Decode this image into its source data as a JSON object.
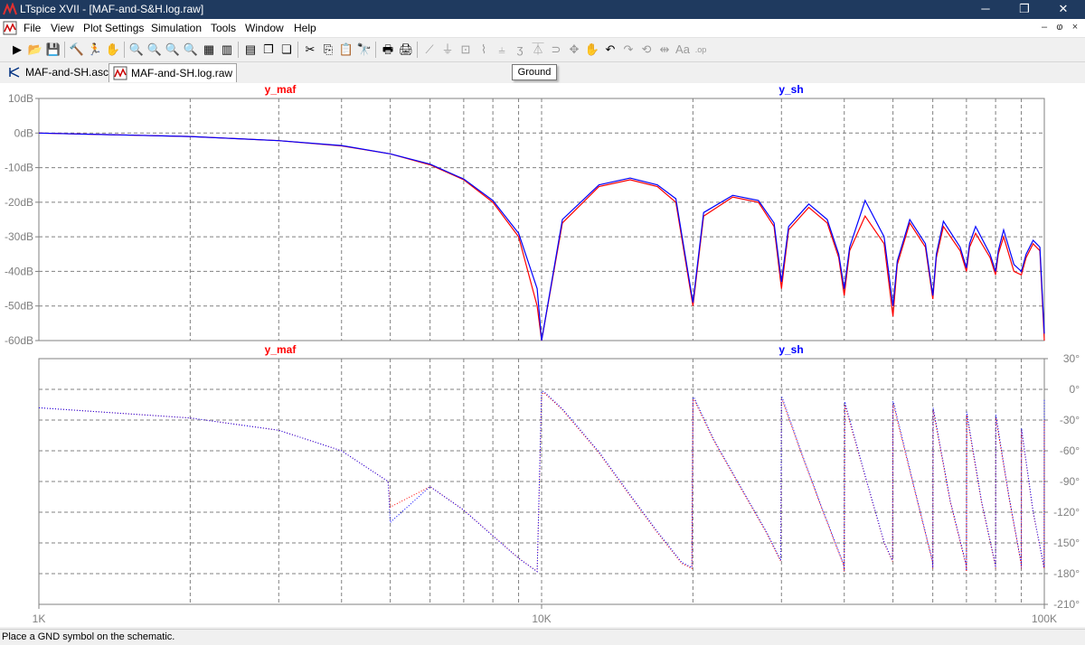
{
  "window": {
    "title": "LTspice XVII - [MAF-and-S&H.log.raw]",
    "minimize": "─",
    "restore": "❐",
    "close": "✕"
  },
  "menu": {
    "items": [
      "File",
      "View",
      "Plot Settings",
      "Simulation",
      "Tools",
      "Window",
      "Help"
    ],
    "mdi": {
      "minimize": "–",
      "restore": "ⱷ",
      "close": "×"
    }
  },
  "toolbar": {
    "buttons": [
      {
        "name": "new-schematic-icon",
        "glyph": "▶",
        "enabled": true
      },
      {
        "name": "open-icon",
        "glyph": "📂",
        "enabled": true
      },
      {
        "name": "save-icon",
        "glyph": "💾",
        "enabled": true
      },
      {
        "name": "control-panel-icon",
        "glyph": "🔨",
        "enabled": true
      },
      {
        "name": "run-icon",
        "glyph": "🏃",
        "enabled": false
      },
      {
        "name": "halt-icon",
        "glyph": "✋",
        "enabled": false
      },
      {
        "name": "zoom-area-icon",
        "glyph": "🔍",
        "enabled": true
      },
      {
        "name": "zoom-back-icon",
        "glyph": "🔍",
        "enabled": true
      },
      {
        "name": "zoom-out-icon",
        "glyph": "🔍",
        "enabled": true
      },
      {
        "name": "zoom-fit-icon",
        "glyph": "🔍",
        "enabled": true
      },
      {
        "name": "autorange-icon",
        "glyph": "▦",
        "enabled": true
      },
      {
        "name": "mark-unref-icon",
        "glyph": "▥",
        "enabled": true
      },
      {
        "name": "tile-horizontal-icon",
        "glyph": "▤",
        "enabled": true
      },
      {
        "name": "cascade-icon",
        "glyph": "❐",
        "enabled": true
      },
      {
        "name": "tile-vertical-icon",
        "glyph": "❏",
        "enabled": true
      },
      {
        "name": "cut-icon",
        "glyph": "✂",
        "enabled": true
      },
      {
        "name": "copy-icon",
        "glyph": "⎘",
        "enabled": true
      },
      {
        "name": "paste-icon",
        "glyph": "📋",
        "enabled": true
      },
      {
        "name": "find-icon",
        "glyph": "🔭",
        "enabled": true
      },
      {
        "name": "print-setup-icon",
        "glyph": "🖶",
        "enabled": true
      },
      {
        "name": "print-icon",
        "glyph": "🖨",
        "enabled": true
      },
      {
        "name": "wire-icon",
        "glyph": "⟋",
        "enabled": false
      },
      {
        "name": "ground-icon",
        "glyph": "⏚",
        "enabled": false
      },
      {
        "name": "label-icon",
        "glyph": "⊡",
        "enabled": false
      },
      {
        "name": "resistor-icon",
        "glyph": "⌇",
        "enabled": false
      },
      {
        "name": "capacitor-icon",
        "glyph": "⫨",
        "enabled": false
      },
      {
        "name": "inductor-icon",
        "glyph": "ʒ",
        "enabled": false
      },
      {
        "name": "diode-icon",
        "glyph": "⏄",
        "enabled": false
      },
      {
        "name": "component-icon",
        "glyph": "⊃",
        "enabled": false
      },
      {
        "name": "move-icon",
        "glyph": "✥",
        "enabled": false
      },
      {
        "name": "drag-icon",
        "glyph": "✋",
        "enabled": false
      },
      {
        "name": "undo-icon",
        "glyph": "↶",
        "enabled": true
      },
      {
        "name": "redo-icon",
        "glyph": "↷",
        "enabled": false
      },
      {
        "name": "rotate-icon",
        "glyph": "⟲",
        "enabled": false
      },
      {
        "name": "mirror-icon",
        "glyph": "⇹",
        "enabled": false
      },
      {
        "name": "text-icon",
        "glyph": "Aa",
        "enabled": false
      },
      {
        "name": "spice-directive-icon",
        "glyph": ".op",
        "enabled": false
      }
    ]
  },
  "tooltip": "Ground",
  "tabs": [
    {
      "label": "MAF-and-SH.asc",
      "active": false
    },
    {
      "label": "MAF-and-SH.log.raw",
      "active": true
    }
  ],
  "status": "Place a GND symbol on the schematic.",
  "colors": {
    "y_maf": "#ff0000",
    "y_sh": "#0000ff",
    "grid": "#808080",
    "axis_text": "#808080"
  },
  "chart_data": [
    {
      "type": "line",
      "panel": "magnitude",
      "x_scale": "log",
      "xlim": [
        1000,
        100000
      ],
      "ylim": [
        -60,
        10
      ],
      "y_unit": "dB",
      "y_ticks": [
        "10dB",
        "0dB",
        "-10dB",
        "-20dB",
        "-30dB",
        "-40dB",
        "-50dB",
        "-60dB"
      ],
      "x_ticks": [
        "1K",
        "10K",
        "100K"
      ],
      "grid": true,
      "series": [
        {
          "name": "y_maf",
          "color": "#ff0000",
          "x": [
            1000,
            2000,
            3000,
            4000,
            5000,
            6000,
            7000,
            8000,
            9000,
            9800,
            10000,
            11000,
            13000,
            15000,
            17000,
            18500,
            20000,
            21000,
            24000,
            27000,
            29000,
            30000,
            31000,
            34000,
            37000,
            39000,
            40000,
            41000,
            44000,
            48000,
            50000,
            51000,
            54000,
            58000,
            60000,
            61000,
            63000,
            68000,
            70000,
            71000,
            73000,
            78000,
            80000,
            81000,
            83000,
            87000,
            90000,
            92000,
            95000,
            98000,
            100000
          ],
          "y": [
            0,
            -1,
            -2.2,
            -3.7,
            -6,
            -9.2,
            -13.5,
            -20,
            -30,
            -50,
            -60,
            -26,
            -15.5,
            -13.5,
            -15.5,
            -20,
            -50,
            -24,
            -18.5,
            -20,
            -27,
            -45,
            -28,
            -21.5,
            -26,
            -36,
            -47,
            -34,
            -24,
            -32,
            -53,
            -38,
            -26,
            -33,
            -48,
            -36,
            -27,
            -34,
            -40,
            -33,
            -29,
            -36,
            -41,
            -35,
            -30,
            -40,
            -41,
            -36,
            -32,
            -34,
            -60
          ]
        },
        {
          "name": "y_sh",
          "color": "#0000ff",
          "x": [
            1000,
            2000,
            3000,
            4000,
            5000,
            6000,
            7000,
            8000,
            9000,
            9800,
            10000,
            11000,
            13000,
            15000,
            17000,
            18500,
            20000,
            21000,
            24000,
            27000,
            29000,
            30000,
            31000,
            34000,
            37000,
            39000,
            40000,
            41000,
            44000,
            48000,
            50000,
            51000,
            54000,
            58000,
            60000,
            61000,
            63000,
            68000,
            70000,
            71000,
            73000,
            78000,
            80000,
            81000,
            83000,
            87000,
            90000,
            92000,
            95000,
            98000,
            100000
          ],
          "y": [
            0,
            -1,
            -2.2,
            -3.6,
            -6,
            -9,
            -13.3,
            -19.5,
            -29,
            -45,
            -60,
            -25,
            -15,
            -13,
            -15,
            -19,
            -49,
            -23,
            -18,
            -19.5,
            -26,
            -43,
            -27,
            -20.5,
            -25,
            -35,
            -45,
            -33,
            -19.5,
            -30,
            -50,
            -37,
            -25,
            -32,
            -47,
            -35,
            -25.5,
            -33,
            -39,
            -32,
            -27,
            -35,
            -40,
            -34,
            -28,
            -38,
            -40,
            -35,
            -31,
            -33,
            -58
          ]
        }
      ]
    },
    {
      "type": "scatter",
      "panel": "phase",
      "x_scale": "log",
      "xlim": [
        1000,
        100000
      ],
      "ylim": [
        -210,
        30
      ],
      "y_unit": "°",
      "y_ticks": [
        "30°",
        "0°",
        "-30°",
        "-60°",
        "-90°",
        "-120°",
        "-150°",
        "-180°",
        "-210°"
      ],
      "x_ticks": [
        "1K",
        "10K",
        "100K"
      ],
      "grid": true,
      "series": [
        {
          "name": "y_maf",
          "color": "#ff0000",
          "x": [
            1000,
            2000,
            3000,
            4000,
            4950,
            5000,
            6000,
            7000,
            8000,
            9000,
            9800,
            10000,
            10100,
            11000,
            13000,
            15000,
            17000,
            19000,
            19900,
            20000,
            20100,
            22000,
            25000,
            28000,
            29900,
            30000,
            30100,
            33000,
            36000,
            39900,
            40000,
            40100,
            44000,
            48000,
            49900,
            50000,
            50100,
            55000,
            59900,
            60000,
            60100,
            65000,
            69900,
            70000,
            70100,
            75000,
            79900,
            80000,
            80100,
            85000,
            89900,
            90000,
            90100,
            95000,
            99900,
            100000
          ],
          "y": [
            -18,
            -28,
            -40,
            -60,
            -90,
            -115,
            -95,
            -118,
            -143,
            -165,
            -178,
            -5,
            -3,
            -20,
            -62,
            -104,
            -140,
            -170,
            -175,
            -10,
            -10,
            -50,
            -98,
            -140,
            -168,
            -10,
            -10,
            -65,
            -115,
            -172,
            -178,
            -15,
            -85,
            -150,
            -168,
            -15,
            -15,
            -95,
            -168,
            -175,
            -20,
            -110,
            -172,
            -178,
            -25,
            -110,
            -172,
            -175,
            -28,
            -105,
            -170,
            -175,
            -40,
            -120,
            -175,
            -30
          ]
        },
        {
          "name": "y_sh",
          "color": "#0000ff",
          "x": [
            1000,
            2000,
            3000,
            4000,
            4950,
            5000,
            6000,
            7000,
            8000,
            9000,
            9800,
            10000,
            10100,
            11000,
            13000,
            15000,
            17000,
            19000,
            19900,
            20000,
            20100,
            22000,
            25000,
            28000,
            29900,
            30000,
            30100,
            33000,
            36000,
            39900,
            40000,
            40100,
            44000,
            48000,
            49900,
            50000,
            50100,
            55000,
            59900,
            60000,
            60100,
            65000,
            69900,
            70000,
            70100,
            75000,
            79900,
            80000,
            80100,
            85000,
            89900,
            90000,
            90100,
            95000,
            99900,
            100000
          ],
          "y": [
            -18,
            -28,
            -40,
            -60,
            -90,
            -130,
            -95,
            -118,
            -143,
            -165,
            -178,
            -2,
            -2,
            -19,
            -61,
            -103,
            -139,
            -169,
            -174,
            -8,
            -8,
            -49,
            -97,
            -139,
            -167,
            -8,
            -8,
            -64,
            -114,
            -171,
            -177,
            -12,
            -84,
            -149,
            -167,
            -12,
            -12,
            -94,
            -167,
            -174,
            -18,
            -109,
            -171,
            -177,
            -22,
            -109,
            -171,
            -174,
            -25,
            -104,
            -169,
            -174,
            -38,
            -119,
            -174,
            -10
          ]
        }
      ]
    }
  ]
}
